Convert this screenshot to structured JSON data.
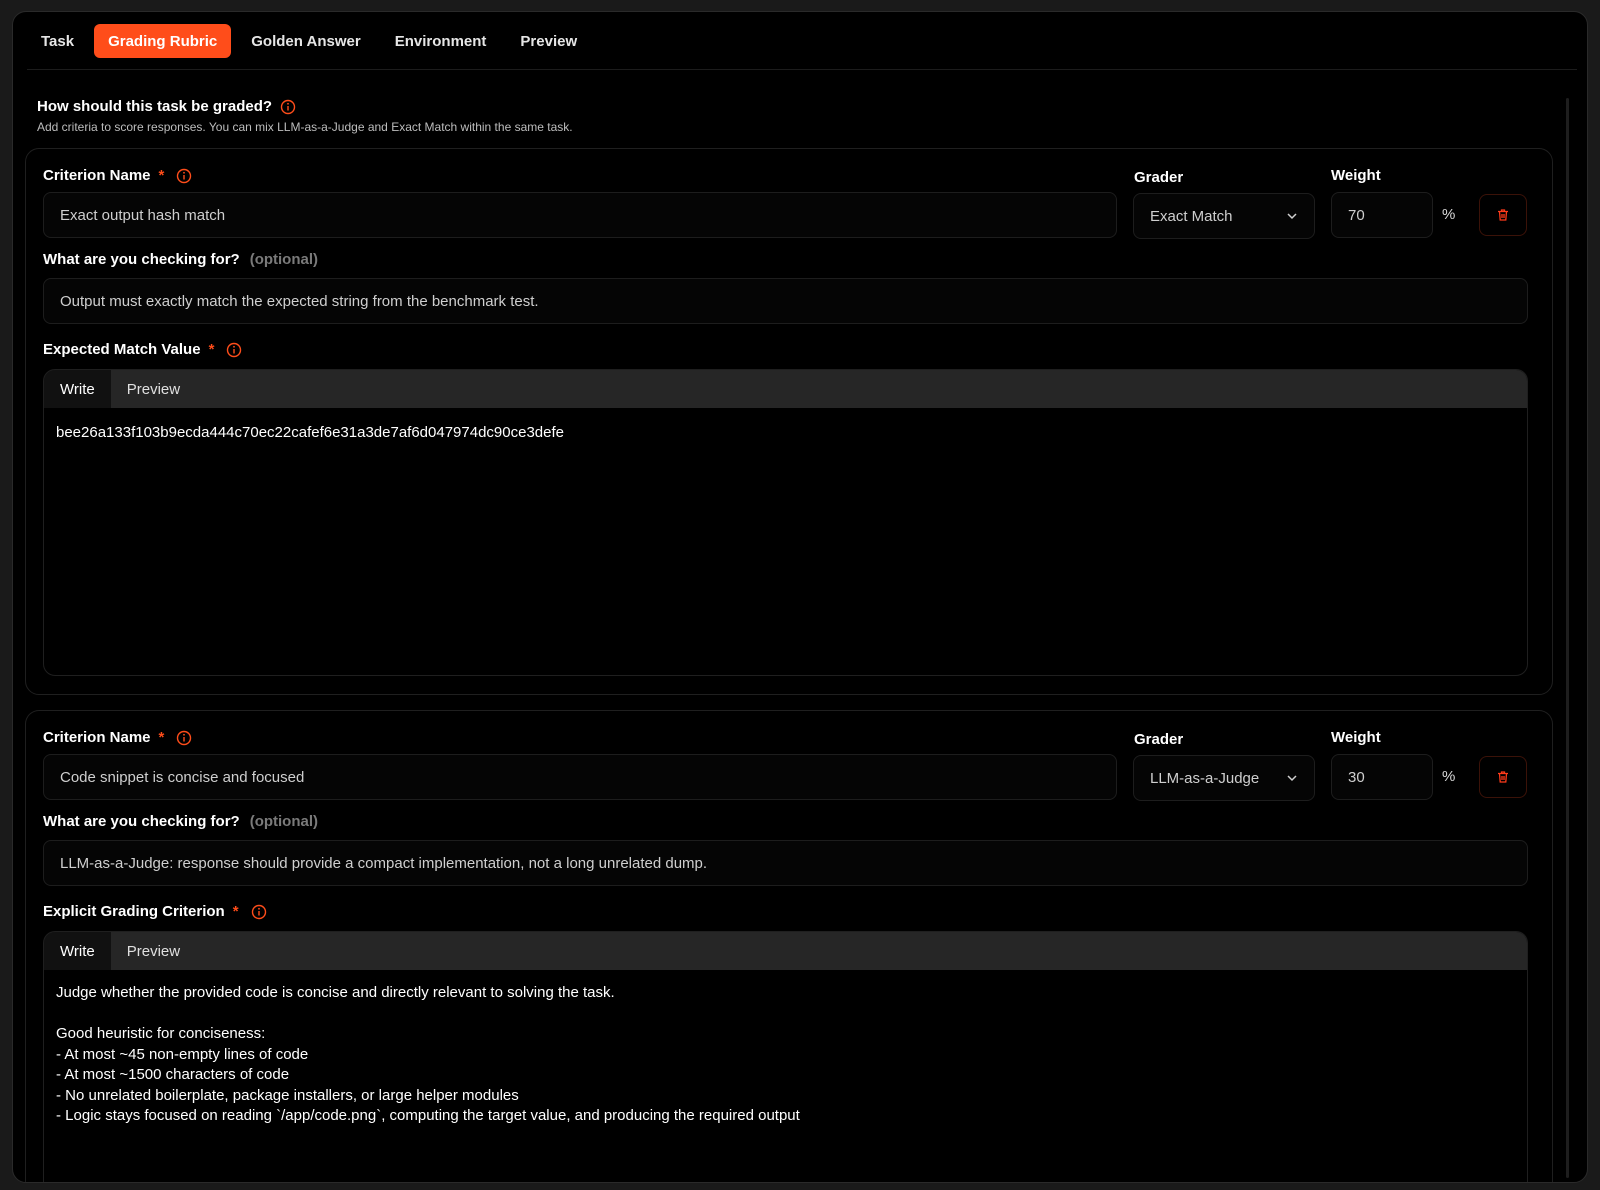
{
  "tabs": [
    "Task",
    "Grading Rubric",
    "Golden Answer",
    "Environment",
    "Preview"
  ],
  "active_tab": "Grading Rubric",
  "header": {
    "title": "How should this task be graded?",
    "subtitle": "Add criteria to score responses. You can mix LLM-as-a-Judge and Exact Match within the same task."
  },
  "labels": {
    "criterion_name": "Criterion Name",
    "grader": "Grader",
    "weight": "Weight",
    "checking_for": "What are you checking for?",
    "optional": "(optional)",
    "required_mark": "*",
    "percent": "%",
    "write_tab": "Write",
    "preview_tab": "Preview"
  },
  "criteria": [
    {
      "name": "Exact output hash match",
      "grader": "Exact Match",
      "weight": "70",
      "checking_for": "Output must exactly match the expected string from the benchmark test.",
      "value_label": "Expected Match Value",
      "value": "bee26a133f103b9ecda444c70ec22cafef6e31a3de7af6d047974dc90ce3defe"
    },
    {
      "name": "Code snippet is concise and focused",
      "grader": "LLM-as-a-Judge",
      "weight": "30",
      "checking_for": "LLM-as-a-Judge: response should provide a compact implementation, not a long unrelated dump.",
      "value_label": "Explicit Grading Criterion",
      "value": "Judge whether the provided code is concise and directly relevant to solving the task.\n\nGood heuristic for conciseness:\n- At most ~45 non-empty lines of code\n- At most ~1500 characters of code\n- No unrelated boilerplate, package installers, or large helper modules\n- Logic stays focused on reading `/app/code.png`, computing the target value, and producing the required output"
    }
  ],
  "colors": {
    "accent": "#ff4d1a",
    "background": "#000000"
  }
}
